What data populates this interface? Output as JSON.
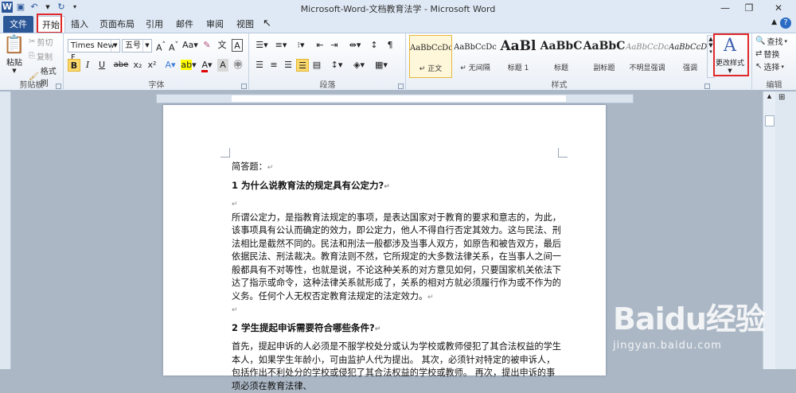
{
  "window": {
    "title": "Microsoft-Word-文档教育法学 - Microsoft Word",
    "app_icon": "W"
  },
  "tabs": [
    {
      "label": "文件"
    },
    {
      "label": "开始"
    },
    {
      "label": "插入"
    },
    {
      "label": "页面布局"
    },
    {
      "label": "引用"
    },
    {
      "label": "邮件"
    },
    {
      "label": "审阅"
    },
    {
      "label": "视图"
    }
  ],
  "right_tools": {
    "ime": "中"
  },
  "clipboard": {
    "paste": "粘贴",
    "cut": "剪切",
    "copy": "复制",
    "painter": "格式刷",
    "label": "剪贴板"
  },
  "font": {
    "name": "Times New F",
    "size": "五号",
    "label": "字体",
    "bold": "B",
    "italic": "I",
    "underline": "U",
    "strike": "abe",
    "sub": "x₂",
    "sup": "x²"
  },
  "paragraph": {
    "label": "段落"
  },
  "styles": {
    "label": "样式",
    "items": [
      {
        "sample": "AaBbCcDc",
        "name": "↵ 正文"
      },
      {
        "sample": "AaBbCcDc",
        "name": "↵ 无间隔"
      },
      {
        "sample": "AaBl",
        "name": "标题 1"
      },
      {
        "sample": "AaBbC",
        "name": "标题"
      },
      {
        "sample": "AaBbC",
        "name": "副标题"
      },
      {
        "sample": "AaBbCcDc",
        "name": "不明显强调"
      },
      {
        "sample": "AaBbCcDc",
        "name": "强调"
      }
    ],
    "change_styles": "更改样式"
  },
  "editing": {
    "label": "编辑",
    "find": "查找",
    "replace": "替换",
    "select": "选择"
  },
  "document": {
    "intro": "简答题：",
    "q1": "1 为什么说教育法的规定具有公定力?",
    "a1": "所谓公定力，是指教育法规定的事项，是表达国家对于教育的要求和意志的，为此，该事项具有公认而确定的效力，即公定力，他人不得自行否定其效力。这与民法、刑法相比是截然不同的。民法和刑法一般都涉及当事人双方，如原告和被告双方，最后依据民法、刑法裁决。教育法则不然，它所规定的大多数法律关系，在当事人之间一般都具有不对等性，也就是说，不论这种关系的对方意见如何，只要国家机关依法下达了指示或命令，这种法律关系就形成了，关系的相对方就必须履行作为或不作为的义务。任何个人无权否定教育法规定的法定效力。",
    "q2": "2 学生提起申诉需要符合哪些条件?",
    "a2": "首先，提起申诉的人必须是不服学校处分或认为学校或教师侵犯了其合法权益的学生本人，如果学生年龄小，可由监护人代为提出。 其次，必须针对特定的被申诉人，包括作出不利处分的学校或侵犯了其合法权益的学校或教师。 再次，提出申诉的事项必须在教育法律、",
    "mark": "↵"
  },
  "watermark": {
    "logo": "Baidu经验",
    "url": "jingyan.baidu.com"
  }
}
